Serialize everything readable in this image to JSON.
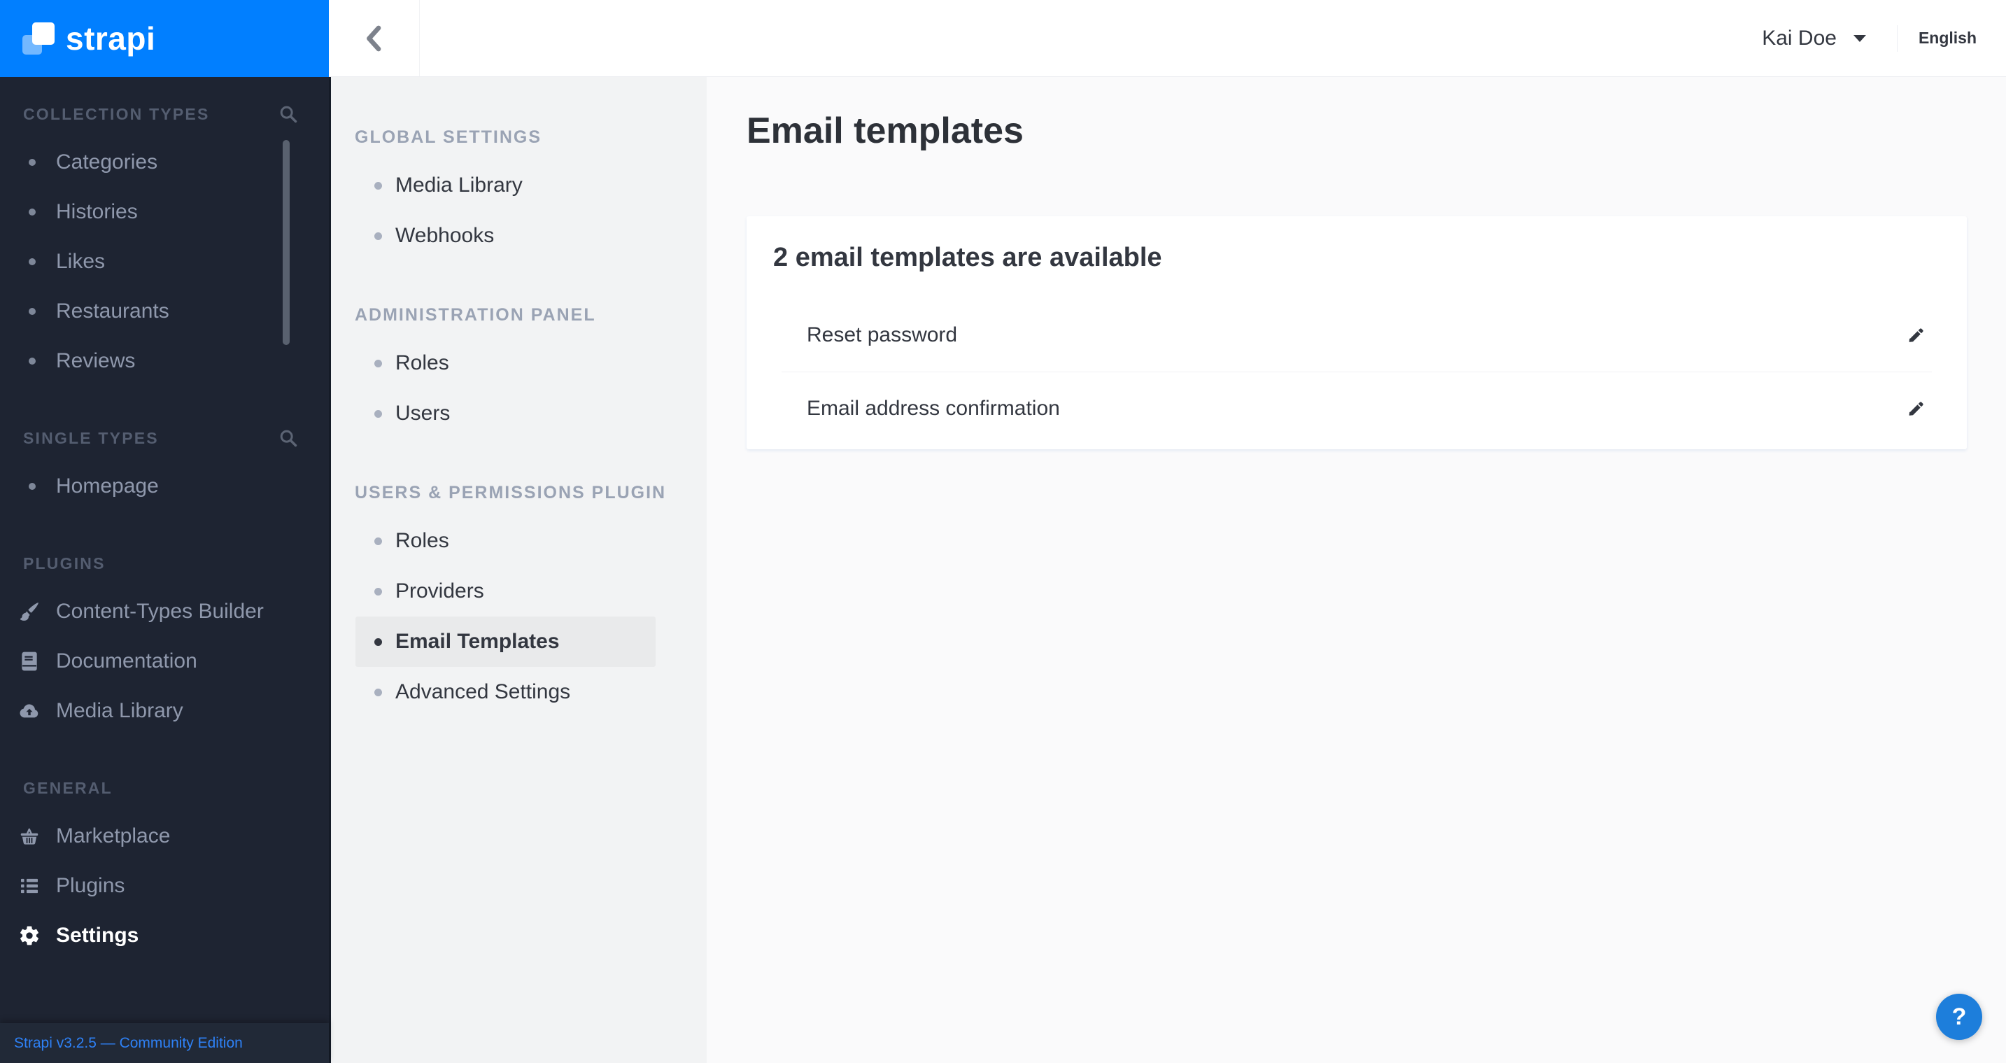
{
  "brand": {
    "logo_text": "strapi"
  },
  "topbar": {
    "user_name": "Kai Doe",
    "language_label": "English"
  },
  "main_sidebar": {
    "sections": [
      {
        "label": "COLLECTION TYPES",
        "has_search": true,
        "items": [
          {
            "label": "Categories"
          },
          {
            "label": "Histories"
          },
          {
            "label": "Likes"
          },
          {
            "label": "Restaurants"
          },
          {
            "label": "Reviews"
          }
        ]
      },
      {
        "label": "SINGLE TYPES",
        "has_search": true,
        "items": [
          {
            "label": "Homepage"
          }
        ]
      },
      {
        "label": "PLUGINS",
        "items": [
          {
            "label": "Content-Types Builder",
            "icon": "paint-brush-icon"
          },
          {
            "label": "Documentation",
            "icon": "book-icon"
          },
          {
            "label": "Media Library",
            "icon": "cloud-upload-icon"
          }
        ]
      },
      {
        "label": "GENERAL",
        "items": [
          {
            "label": "Marketplace",
            "icon": "basket-icon"
          },
          {
            "label": "Plugins",
            "icon": "list-icon"
          },
          {
            "label": "Settings",
            "icon": "gear-icon",
            "active": true
          }
        ]
      }
    ],
    "footer": {
      "version_text": "Strapi v3.2.5 — Community Edition"
    }
  },
  "subnav": {
    "sections": [
      {
        "label": "GLOBAL SETTINGS",
        "items": [
          {
            "label": "Media Library"
          },
          {
            "label": "Webhooks"
          }
        ]
      },
      {
        "label": "ADMINISTRATION PANEL",
        "items": [
          {
            "label": "Roles"
          },
          {
            "label": "Users"
          }
        ]
      },
      {
        "label": "USERS & PERMISSIONS PLUGIN",
        "items": [
          {
            "label": "Roles"
          },
          {
            "label": "Providers"
          },
          {
            "label": "Email Templates",
            "active": true
          },
          {
            "label": "Advanced Settings"
          }
        ]
      }
    ]
  },
  "content": {
    "page_title": "Email templates",
    "card": {
      "title": "2 email templates are available",
      "rows": [
        {
          "label": "Reset password"
        },
        {
          "label": "Email address confirmation"
        }
      ]
    }
  },
  "help_button": {
    "label": "?"
  },
  "colors": {
    "brand_blue": "#017fff",
    "sidebar_bg": "#1e2432",
    "sidebar_footer_bg": "#212937",
    "sidebar_text": "#8f98ac",
    "subnav_bg": "#f2f3f4",
    "subnav_selected_bg": "#e9eaeb",
    "content_bg": "#fafafb",
    "text_dark": "#333740",
    "link_blue": "#2e81f6",
    "help_button_blue": "#1d7edb"
  }
}
